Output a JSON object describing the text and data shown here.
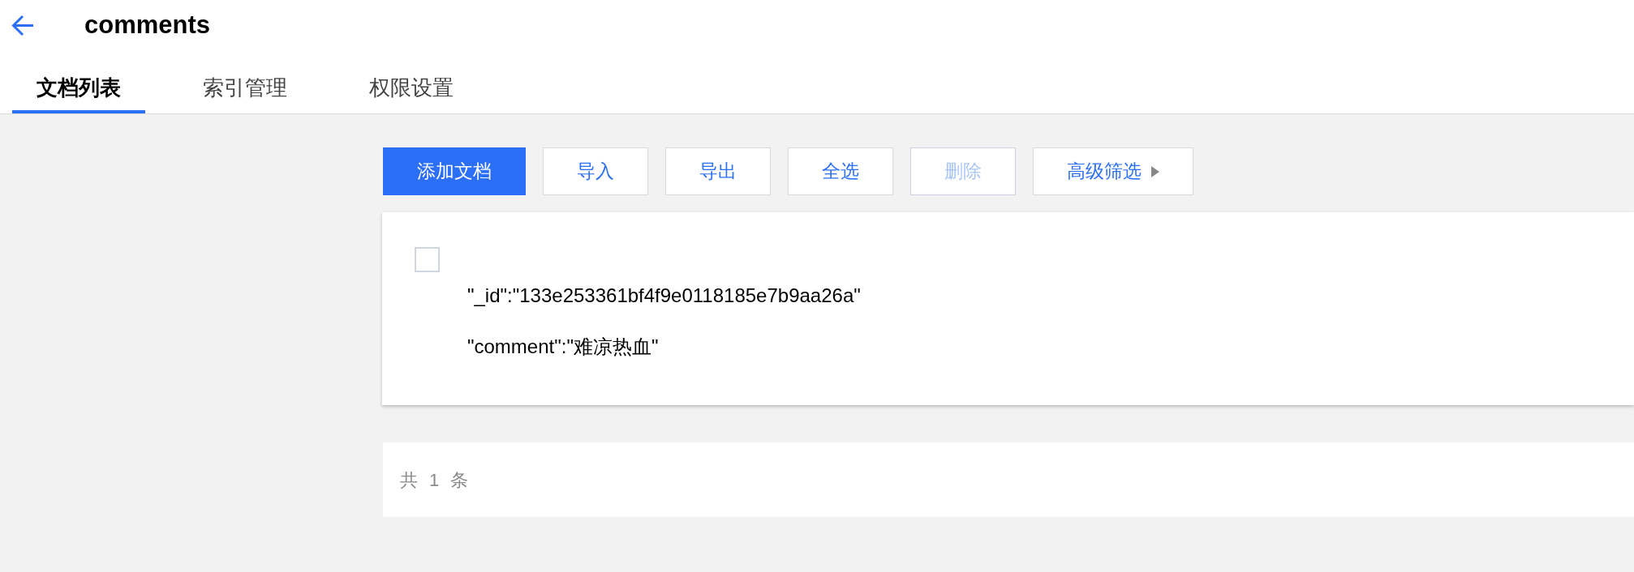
{
  "header": {
    "title": "comments"
  },
  "tabs": [
    {
      "label": "文档列表",
      "selected": true
    },
    {
      "label": "索引管理",
      "selected": false
    },
    {
      "label": "权限设置",
      "selected": false
    }
  ],
  "toolbar": {
    "buttons": [
      {
        "label": "添加文档",
        "kind": "primary",
        "disabled": false
      },
      {
        "label": "导入",
        "kind": "default",
        "disabled": false
      },
      {
        "label": "导出",
        "kind": "default",
        "disabled": false
      },
      {
        "label": "全选",
        "kind": "default",
        "disabled": false
      },
      {
        "label": "删除",
        "kind": "default",
        "disabled": true
      },
      {
        "label": "高级筛选",
        "kind": "dropdown",
        "disabled": false
      }
    ]
  },
  "documents": [
    {
      "checked": false,
      "fields": [
        "\"_id\":\"133e253361bf4f9e0118185e7b9aa26a\"",
        "\"comment\":\"难凉热血\""
      ]
    }
  ],
  "footer": {
    "total": "共 1 条"
  }
}
